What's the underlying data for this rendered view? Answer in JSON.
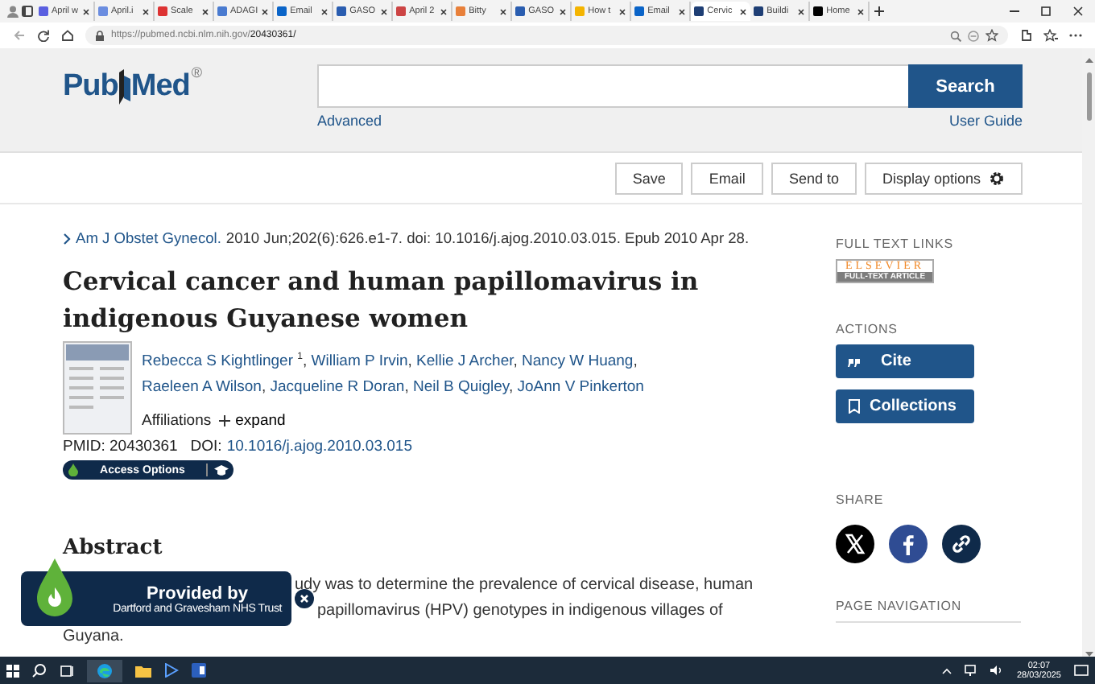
{
  "browser": {
    "tabs": [
      {
        "label": "April w",
        "selected": false
      },
      {
        "label": "April.i",
        "selected": false
      },
      {
        "label": "Scale",
        "selected": false
      },
      {
        "label": "ADAGI",
        "selected": false
      },
      {
        "label": "Email",
        "selected": false
      },
      {
        "label": "GASO",
        "selected": false
      },
      {
        "label": "April 2",
        "selected": false
      },
      {
        "label": "Bitty",
        "selected": false
      },
      {
        "label": "GASO",
        "selected": false
      },
      {
        "label": "How t",
        "selected": false
      },
      {
        "label": "Email",
        "selected": false
      },
      {
        "label": "Cervic",
        "selected": true
      },
      {
        "label": "Buildi",
        "selected": false
      },
      {
        "label": "Home",
        "selected": false
      }
    ],
    "url_host": "https://pubmed.ncbi.nlm.nih.gov/",
    "url_path": "20430361/"
  },
  "header": {
    "logo": {
      "left": "Pub",
      "right": "Med",
      "mark": "®"
    },
    "search_button": "Search",
    "advanced": "Advanced",
    "user_guide": "User Guide"
  },
  "toolbar": [
    "Save",
    "Email",
    "Send to",
    "Display options"
  ],
  "article": {
    "journal": "Am J Obstet Gynecol.",
    "citation": "2010 Jun;202(6):626.e1-7. doi: 10.1016/j.ajog.2010.03.015. Epub 2010 Apr 28.",
    "title": "Cervical cancer and human papillomavirus in indigenous Guyanese women",
    "authors": [
      {
        "name": "Rebecca S Kightlinger",
        "note": "1",
        "sep": ","
      },
      {
        "name": "William P Irvin",
        "sep": ","
      },
      {
        "name": "Kellie J Archer",
        "sep": ","
      },
      {
        "name": "Nancy W Huang",
        "sep": ","
      },
      {
        "name": "Raeleen A Wilson",
        "sep": ","
      },
      {
        "name": "Jacqueline R Doran",
        "sep": ","
      },
      {
        "name": "Neil B Quigley",
        "sep": ","
      },
      {
        "name": "JoAnn V Pinkerton"
      }
    ],
    "affiliations": "Affiliations",
    "expand": "expand",
    "pmid": "PMID: 20430361",
    "doi_label": "DOI:",
    "doi": "10.1016/j.ajog.2010.03.015",
    "access": "Access Options"
  },
  "abstract": {
    "heading": "Abstract",
    "lines": [
      "udy was to determine the prevalence of cervical disease, human",
      "papillomavirus (HPV) genotypes in indigenous villages of",
      "Guyana."
    ]
  },
  "sidebar": {
    "full_text_heading": "FULL TEXT LINKS",
    "publisher": {
      "top": "ELSEVIER",
      "bottom": "FULL-TEXT ARTICLE"
    },
    "actions_heading": "ACTIONS",
    "actions": [
      {
        "label": "Cite",
        "kind": "cite"
      },
      {
        "label": "Collections",
        "kind": "collections"
      }
    ],
    "share_heading": "SHARE",
    "share": [
      {
        "kind": "x"
      },
      {
        "kind": "facebook"
      },
      {
        "kind": "link"
      }
    ],
    "nav_heading": "PAGE NAVIGATION"
  },
  "popup": {
    "title": "Provided by",
    "subtitle": "Dartford and Gravesham NHS Trust"
  },
  "taskbar": {
    "time": "02:07",
    "date": "28/03/2025"
  }
}
